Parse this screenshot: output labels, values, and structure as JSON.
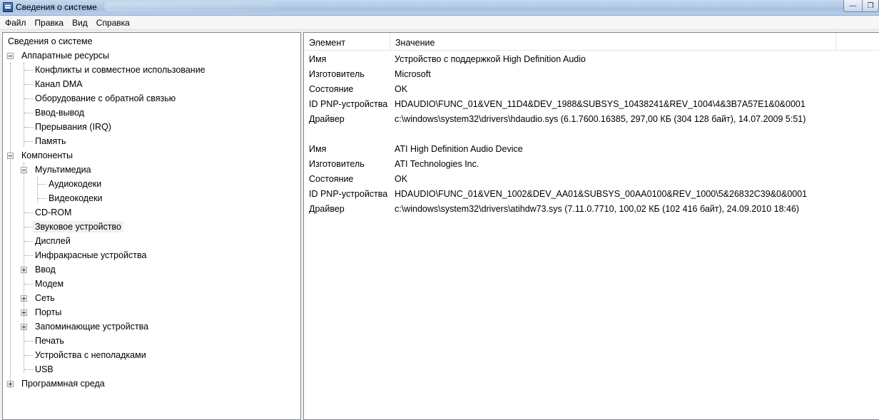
{
  "window": {
    "title": "Сведения о системе",
    "controls": {
      "minimize": "—",
      "maximize": "❐"
    }
  },
  "menu": [
    "Файл",
    "Правка",
    "Вид",
    "Справка"
  ],
  "tree": {
    "root": "Сведения о системе",
    "items": [
      "Аппаратные ресурсы",
      "Конфликты и совместное использование",
      "Канал DMA",
      "Оборудование с обратной связью",
      "Ввод-вывод",
      "Прерывания (IRQ)",
      "Память",
      "Компоненты",
      "Мультимедиа",
      "Аудиокодеки",
      "Видеокодеки",
      "CD-ROM",
      "Звуковое устройство",
      "Дисплей",
      "Инфракрасные устройства",
      "Ввод",
      "Модем",
      "Сеть",
      "Порты",
      "Запоминающие устройства",
      "Печать",
      "Устройства с неполадками",
      "USB",
      "Программная среда"
    ],
    "selected": "Звуковое устройство"
  },
  "table": {
    "headers": [
      "Элемент",
      "Значение"
    ],
    "rows": [
      [
        "Имя",
        "Устройство с поддержкой High Definition Audio"
      ],
      [
        "Изготовитель",
        "Microsoft"
      ],
      [
        "Состояние",
        "OK"
      ],
      [
        "ID PNP-устройства",
        "HDAUDIO\\FUNC_01&VEN_11D4&DEV_1988&SUBSYS_10438241&REV_1004\\4&3B7A57E1&0&0001"
      ],
      [
        "Драйвер",
        "c:\\windows\\system32\\drivers\\hdaudio.sys (6.1.7600.16385, 297,00 КБ (304 128 байт), 14.07.2009 5:51)"
      ],
      [
        "",
        ""
      ],
      [
        "Имя",
        "ATI High Definition Audio Device"
      ],
      [
        "Изготовитель",
        "ATI Technologies Inc."
      ],
      [
        "Состояние",
        "OK"
      ],
      [
        "ID PNP-устройства",
        "HDAUDIO\\FUNC_01&VEN_1002&DEV_AA01&SUBSYS_00AA0100&REV_1000\\5&26832C39&0&0001"
      ],
      [
        "Драйвер",
        "c:\\windows\\system32\\drivers\\atihdw73.sys (7.11.0.7710, 100,02 КБ (102 416 байт), 24.09.2010 18:46)"
      ]
    ]
  }
}
